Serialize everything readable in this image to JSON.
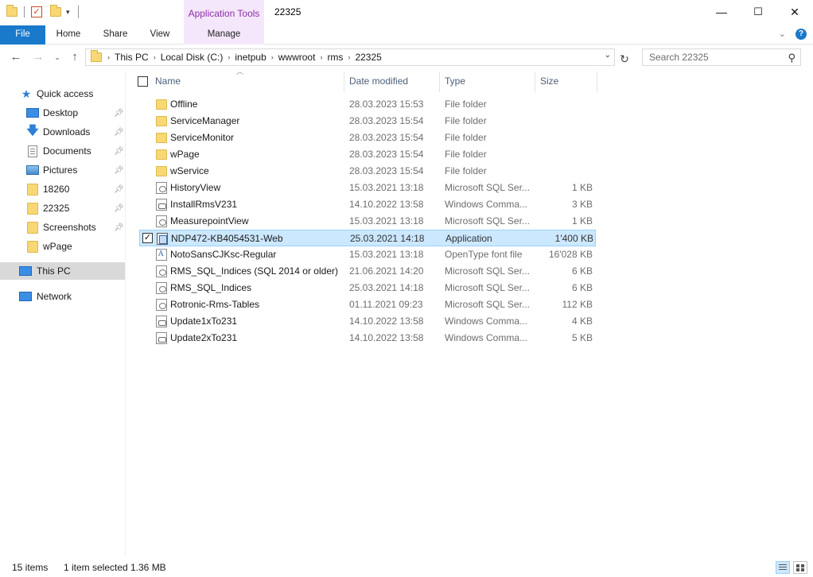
{
  "window": {
    "title": "22325",
    "context_tab_group": "Application Tools",
    "minimize": "—",
    "maximize": "☐",
    "close": "✕"
  },
  "ribbon": {
    "tabs": [
      "File",
      "Home",
      "Share",
      "View",
      "Manage"
    ]
  },
  "address": {
    "crumbs": [
      "This PC",
      "Local Disk (C:)",
      "inetpub",
      "wwwroot",
      "rms",
      "22325"
    ]
  },
  "search": {
    "placeholder": "Search 22325"
  },
  "nav": {
    "quick_access": "Quick access",
    "items": [
      {
        "label": "Desktop",
        "icon": "desktop-icon",
        "pinned": true
      },
      {
        "label": "Downloads",
        "icon": "download-icon",
        "pinned": true
      },
      {
        "label": "Documents",
        "icon": "documents-icon",
        "pinned": true
      },
      {
        "label": "Pictures",
        "icon": "pictures-icon",
        "pinned": true
      },
      {
        "label": "18260",
        "icon": "folder-icon",
        "pinned": true
      },
      {
        "label": "22325",
        "icon": "folder-icon",
        "pinned": true
      },
      {
        "label": "Screenshots",
        "icon": "folder-icon",
        "pinned": true
      },
      {
        "label": "wPage",
        "icon": "folder-icon",
        "pinned": false
      }
    ],
    "this_pc": "This PC",
    "network": "Network"
  },
  "columns": {
    "name": "Name",
    "date": "Date modified",
    "type": "Type",
    "size": "Size"
  },
  "files": [
    {
      "name": "Offline",
      "date": "28.03.2023 15:53",
      "type": "File folder",
      "size": "",
      "icon": "folder"
    },
    {
      "name": "ServiceManager",
      "date": "28.03.2023 15:54",
      "type": "File folder",
      "size": "",
      "icon": "folder"
    },
    {
      "name": "ServiceMonitor",
      "date": "28.03.2023 15:54",
      "type": "File folder",
      "size": "",
      "icon": "folder"
    },
    {
      "name": "wPage",
      "date": "28.03.2023 15:54",
      "type": "File folder",
      "size": "",
      "icon": "folder"
    },
    {
      "name": "wService",
      "date": "28.03.2023 15:54",
      "type": "File folder",
      "size": "",
      "icon": "folder"
    },
    {
      "name": "HistoryView",
      "date": "15.03.2021 13:18",
      "type": "Microsoft SQL Ser...",
      "size": "1 KB",
      "icon": "sql"
    },
    {
      "name": "InstallRmsV231",
      "date": "14.10.2022 13:58",
      "type": "Windows Comma...",
      "size": "3 KB",
      "icon": "cmd"
    },
    {
      "name": "MeasurepointView",
      "date": "15.03.2021 13:18",
      "type": "Microsoft SQL Ser...",
      "size": "1 KB",
      "icon": "sql"
    },
    {
      "name": "NDP472-KB4054531-Web",
      "date": "25.03.2021 14:18",
      "type": "Application",
      "size": "1'400 KB",
      "icon": "app",
      "selected": true
    },
    {
      "name": "NotoSansCJKsc-Regular",
      "date": "15.03.2021 13:18",
      "type": "OpenType font file",
      "size": "16'028 KB",
      "icon": "font"
    },
    {
      "name": "RMS_SQL_Indices (SQL 2014 or older)",
      "date": "21.06.2021 14:20",
      "type": "Microsoft SQL Ser...",
      "size": "6 KB",
      "icon": "sql"
    },
    {
      "name": "RMS_SQL_Indices",
      "date": "25.03.2021 14:18",
      "type": "Microsoft SQL Ser...",
      "size": "6 KB",
      "icon": "sql"
    },
    {
      "name": "Rotronic-Rms-Tables",
      "date": "01.11.2021 09:23",
      "type": "Microsoft SQL Ser...",
      "size": "112 KB",
      "icon": "sql"
    },
    {
      "name": "Update1xTo231",
      "date": "14.10.2022 13:58",
      "type": "Windows Comma...",
      "size": "4 KB",
      "icon": "cmd"
    },
    {
      "name": "Update2xTo231",
      "date": "14.10.2022 13:58",
      "type": "Windows Comma...",
      "size": "5 KB",
      "icon": "cmd"
    }
  ],
  "status": {
    "items": "15 items",
    "selected": "1 item selected",
    "size": "1.36 MB"
  },
  "colors": {
    "accent": "#1979ca",
    "selection": "#cce8ff",
    "context_tab": "#f5e7fb"
  }
}
